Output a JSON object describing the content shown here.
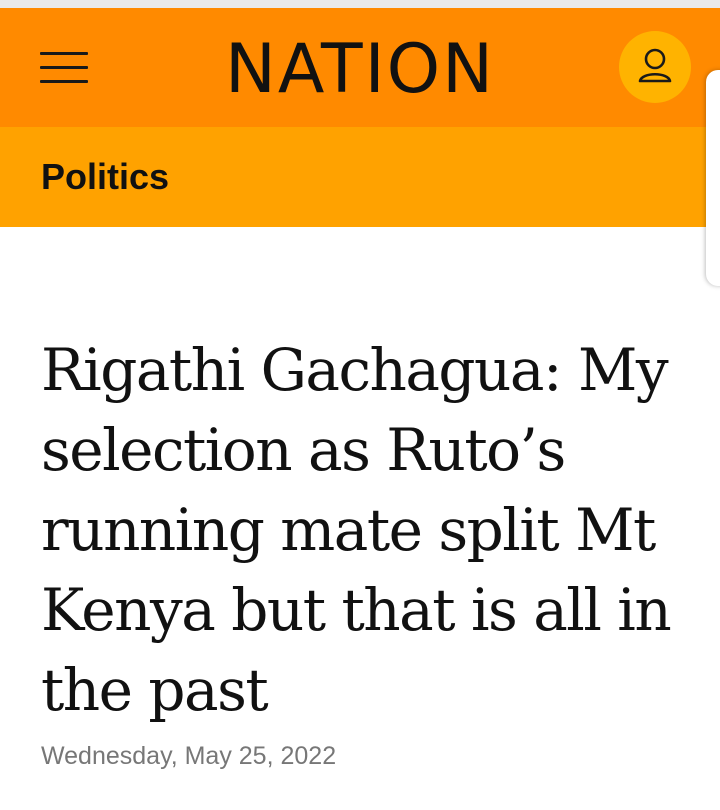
{
  "header": {
    "logo_text": "NATION",
    "menu_icon": "hamburger-menu-icon",
    "account_icon": "user-account-icon",
    "colors": {
      "header_bg": "#ff8a00",
      "section_bg": "#ffa200",
      "account_bg": "#ffb300"
    }
  },
  "section": {
    "label": "Politics"
  },
  "article": {
    "headline": "Rigathi Gachagua: My selection as Ruto’s running mate split Mt Kenya but that is all in the past",
    "date": "Wednesday, May 25, 2022"
  }
}
